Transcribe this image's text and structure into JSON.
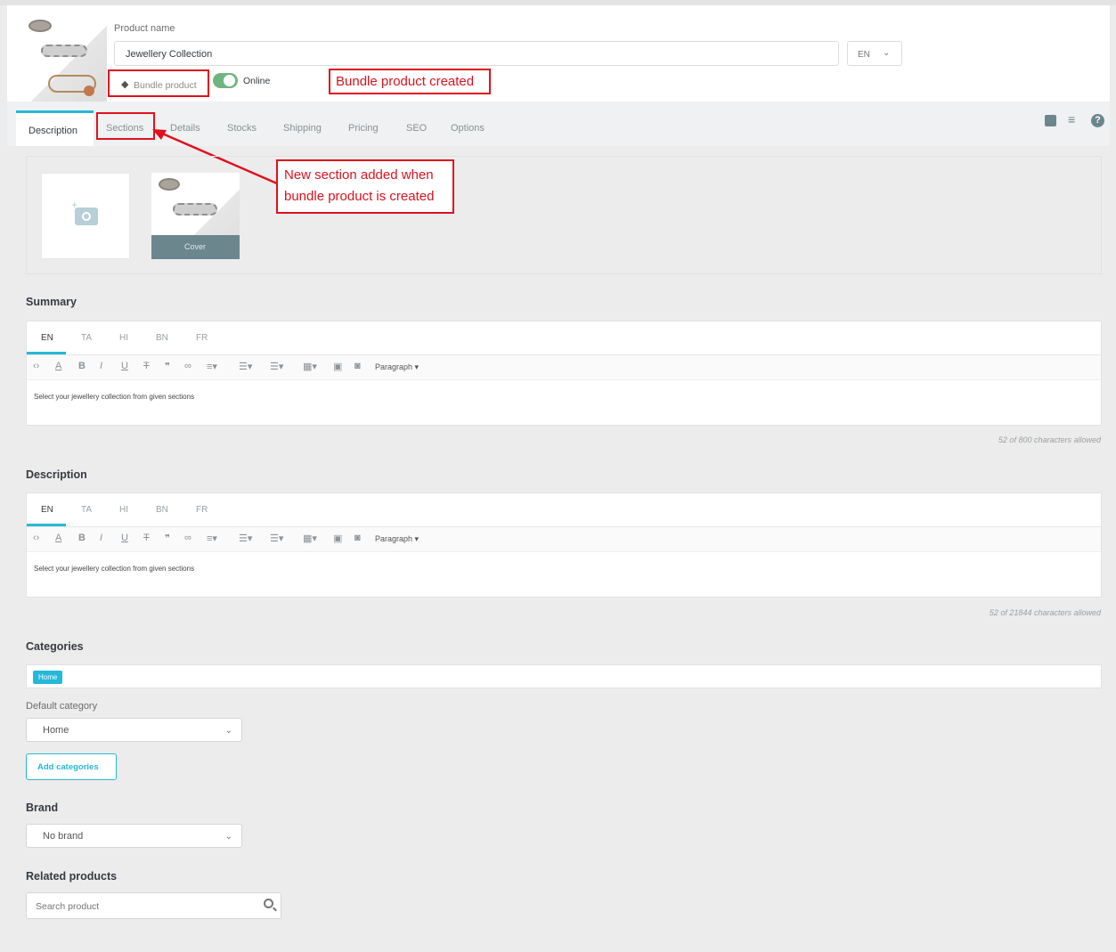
{
  "header": {
    "product_name_label": "Product name",
    "product_name_value": "Jewellery Collection",
    "lang": "EN",
    "bundle_label": "Bundle product",
    "online_label": "Online"
  },
  "annotations": {
    "bundle_created": "Bundle product created",
    "new_section_line1": "New section added when",
    "new_section_line2": "bundle product is created"
  },
  "tabs": [
    "Description",
    "Sections",
    "Details",
    "Stocks",
    "Shipping",
    "Pricing",
    "SEO",
    "Options"
  ],
  "images": {
    "cover_label": "Cover"
  },
  "summary": {
    "title": "Summary",
    "langs": [
      "EN",
      "TA",
      "HI",
      "BN",
      "FR"
    ],
    "paragraph": "Paragraph",
    "text": "Select your jewellery collection from given sections",
    "counter": "52 of 800 characters allowed"
  },
  "description": {
    "title": "Description",
    "langs": [
      "EN",
      "TA",
      "HI",
      "BN",
      "FR"
    ],
    "paragraph": "Paragraph",
    "text": "Select your jewellery collection from given sections",
    "counter": "52 of 21844 characters allowed"
  },
  "categories": {
    "title": "Categories",
    "tag": "Home",
    "default_label": "Default category",
    "default_value": "Home",
    "add_button": "Add categories"
  },
  "brand": {
    "title": "Brand",
    "value": "No brand"
  },
  "related": {
    "title": "Related products",
    "placeholder": "Search product"
  },
  "colors": {
    "accent": "#25b9d7",
    "annotation": "#e0101e",
    "toggle": "#70b580"
  }
}
